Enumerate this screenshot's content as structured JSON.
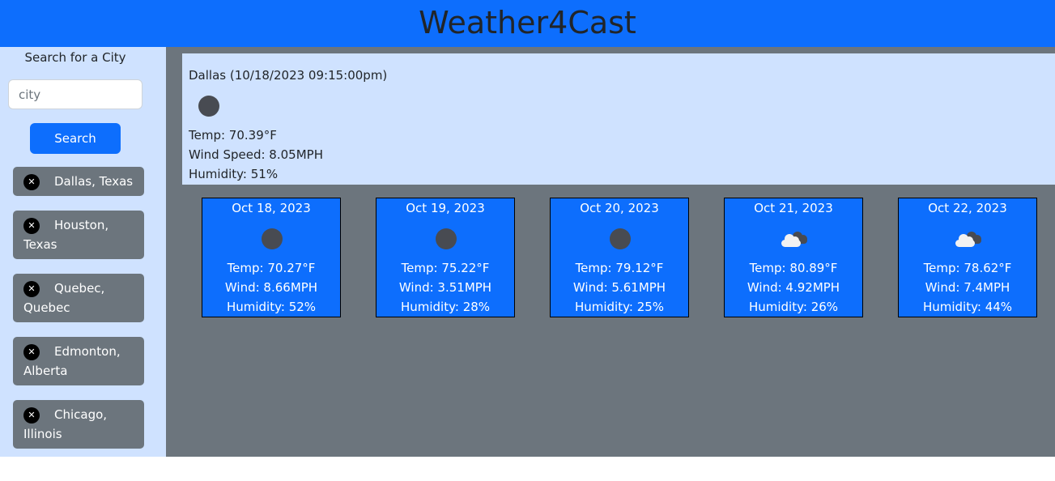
{
  "header": {
    "title": "Weather4Cast"
  },
  "sidebar": {
    "search_label": "Search for a City",
    "input_placeholder": "city",
    "input_value": "",
    "search_button": "Search",
    "history": [
      {
        "line1": "Dallas, Texas",
        "line2": ""
      },
      {
        "line1": "Houston,",
        "line2": "Texas"
      },
      {
        "line1": "Quebec,",
        "line2": "Quebec"
      },
      {
        "line1": "Edmonton,",
        "line2": "Alberta"
      },
      {
        "line1": "Chicago,",
        "line2": "Illinois"
      }
    ]
  },
  "current": {
    "title": "Dallas (10/18/2023 09:15:00pm)",
    "icon": "clear-night-moon-icon",
    "temp": "Temp: 70.39°F",
    "wind": "Wind Speed: 8.05MPH",
    "humidity": "Humidity: 51%"
  },
  "forecast": [
    {
      "date": "Oct 18, 2023",
      "icon": "clear-night-moon-icon",
      "temp": "Temp: 70.27°F",
      "wind": "Wind: 8.66MPH",
      "humidity": "Humidity: 52%"
    },
    {
      "date": "Oct 19, 2023",
      "icon": "clear-night-moon-icon",
      "temp": "Temp: 75.22°F",
      "wind": "Wind: 3.51MPH",
      "humidity": "Humidity: 28%"
    },
    {
      "date": "Oct 20, 2023",
      "icon": "clear-night-moon-icon",
      "temp": "Temp: 79.12°F",
      "wind": "Wind: 5.61MPH",
      "humidity": "Humidity: 25%"
    },
    {
      "date": "Oct 21, 2023",
      "icon": "broken-clouds-icon",
      "temp": "Temp: 80.89°F",
      "wind": "Wind: 4.92MPH",
      "humidity": "Humidity: 26%"
    },
    {
      "date": "Oct 22, 2023",
      "icon": "broken-clouds-icon",
      "temp": "Temp: 78.62°F",
      "wind": "Wind: 7.4MPH",
      "humidity": "Humidity: 44%"
    }
  ],
  "colors": {
    "primary": "#0d6efd",
    "sidebar_bg": "#cfe2ff",
    "main_bg": "#6c757d"
  }
}
